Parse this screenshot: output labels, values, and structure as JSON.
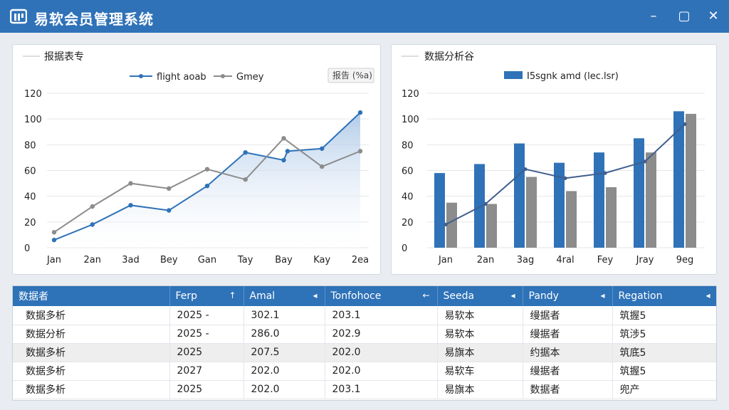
{
  "app": {
    "title": "易软会员管理系统",
    "window_controls": [
      "–",
      "▢",
      "✕"
    ]
  },
  "colors": {
    "accent": "#2f72b8",
    "series_blue": "#2f72b8",
    "series_gray": "#8c8c8c",
    "area_fill": "#c9dbee"
  },
  "left_panel": {
    "title": "报据表专",
    "badge": "报告 (%a)",
    "legend": [
      "flight aoab",
      "Gmey"
    ]
  },
  "right_panel": {
    "title": "数据分析谷",
    "legend": [
      "I5sgnk amd (lec.lsr)"
    ]
  },
  "chart_data": [
    {
      "type": "line",
      "title": "报据表专",
      "categories": [
        "Jan",
        "2an",
        "3ad",
        "Bey",
        "Gan",
        "Tay",
        "Bay",
        "Kay",
        "2ea"
      ],
      "y_tick_labels": [
        "0",
        "20",
        "40",
        "60",
        "80",
        "100",
        "120"
      ],
      "ylim": [
        0,
        120
      ],
      "grid": true,
      "legend_position": "top",
      "series": [
        {
          "name": "flight aoab",
          "values": [
            6,
            18,
            33,
            29,
            48,
            74,
            68,
            75,
            77,
            105
          ],
          "points": [
            [
              0,
              6
            ],
            [
              1,
              18
            ],
            [
              2,
              33
            ],
            [
              3,
              29
            ],
            [
              4,
              48
            ],
            [
              5,
              74
            ],
            [
              6,
              68
            ],
            [
              6.1,
              75
            ],
            [
              7,
              77
            ],
            [
              8,
              105
            ]
          ],
          "color": "#2f72b8",
          "area": true
        },
        {
          "name": "Gmey",
          "points": [
            [
              0,
              12
            ],
            [
              1,
              32
            ],
            [
              2,
              50
            ],
            [
              3,
              46
            ],
            [
              4,
              61
            ],
            [
              5,
              53
            ],
            [
              6,
              85
            ],
            [
              7,
              63
            ],
            [
              8,
              75
            ]
          ],
          "color": "#8c8c8c"
        }
      ]
    },
    {
      "type": "bar",
      "title": "数据分析谷",
      "categories": [
        "Jan",
        "2an",
        "3ag",
        "4ral",
        "Fey",
        "Jray",
        "9eg"
      ],
      "y_tick_labels": [
        "0",
        "20",
        "40",
        "60",
        "80",
        "100",
        "120"
      ],
      "ylim": [
        0,
        120
      ],
      "grid": true,
      "legend_position": "top",
      "series": [
        {
          "name": "I5sgnk amd (lec.lsr)",
          "values": [
            58,
            65,
            81,
            66,
            74,
            85,
            106
          ],
          "color": "#2f72b8"
        },
        {
          "values": [
            35,
            34,
            55,
            44,
            47,
            74,
            104
          ],
          "color": "#8c8c8c"
        }
      ],
      "line": {
        "values": [
          18,
          34,
          61,
          54,
          58,
          67,
          96
        ],
        "color": "#3f5f8f"
      }
    }
  ],
  "table": {
    "headers": [
      "数据者",
      "Ferp",
      "Amal",
      "Tonfohoce",
      "Seeda",
      "Pandy",
      "Regation"
    ],
    "sort_glyphs": [
      "",
      "↑",
      "◂",
      "←",
      "◂",
      "◂",
      "◂"
    ],
    "rows": [
      [
        "数据多析",
        "2025",
        "-",
        "302.1",
        "203.1",
        "易软本",
        "缦据者",
        "筑握5"
      ],
      [
        "数据分析",
        "2025",
        "-",
        "286.0",
        "202.9",
        "易软本",
        "缦据者",
        "筑涉5"
      ],
      [
        "数据多析",
        "2025",
        "",
        "207.5",
        "202.0",
        "易旗本",
        "约据本",
        "筑底5"
      ],
      [
        "数据多析",
        "2027",
        "",
        "202.0",
        "202.0",
        "易软车",
        "缦据者",
        "筑握5"
      ],
      [
        "数据多析",
        "2025",
        "",
        "202.0",
        "203.1",
        "易旗本",
        "数据者",
        "兜产"
      ]
    ]
  }
}
